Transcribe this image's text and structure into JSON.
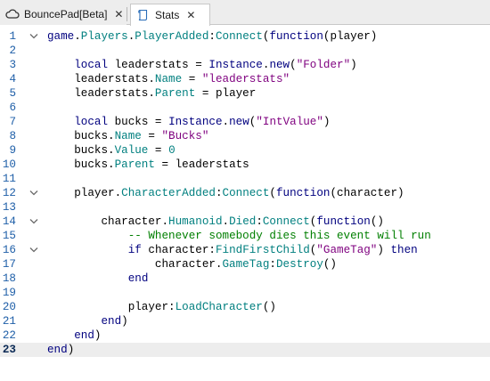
{
  "tabs": [
    {
      "label": "BouncePad[Beta]",
      "icon": "cloud-icon",
      "active": false
    },
    {
      "label": "Stats",
      "icon": "script-icon",
      "active": true
    }
  ],
  "editor": {
    "current_line": 23,
    "lines": [
      {
        "n": "1",
        "fold": true,
        "tokens": [
          [
            "kw",
            "game"
          ],
          [
            "",
            "."
          ],
          [
            "prop",
            "Players"
          ],
          [
            "",
            "."
          ],
          [
            "prop",
            "PlayerAdded"
          ],
          [
            "",
            ":"
          ],
          [
            "prop",
            "Connect"
          ],
          [
            "",
            "("
          ],
          [
            "kw",
            "function"
          ],
          [
            "",
            "(player)"
          ]
        ]
      },
      {
        "n": "2",
        "fold": false,
        "tokens": []
      },
      {
        "n": "3",
        "fold": false,
        "tokens": [
          [
            "",
            "    "
          ],
          [
            "kw",
            "local"
          ],
          [
            "",
            " leaderstats = "
          ],
          [
            "kw",
            "Instance"
          ],
          [
            "",
            "."
          ],
          [
            "kw",
            "new"
          ],
          [
            "",
            "("
          ],
          [
            "str",
            "\"Folder\""
          ],
          [
            "",
            ")"
          ]
        ]
      },
      {
        "n": "4",
        "fold": false,
        "tokens": [
          [
            "",
            "    leaderstats."
          ],
          [
            "prop",
            "Name"
          ],
          [
            "",
            " = "
          ],
          [
            "str",
            "\"leaderstats\""
          ]
        ]
      },
      {
        "n": "5",
        "fold": false,
        "tokens": [
          [
            "",
            "    leaderstats."
          ],
          [
            "prop",
            "Parent"
          ],
          [
            "",
            " = player"
          ]
        ]
      },
      {
        "n": "6",
        "fold": false,
        "tokens": []
      },
      {
        "n": "7",
        "fold": false,
        "tokens": [
          [
            "",
            "    "
          ],
          [
            "kw",
            "local"
          ],
          [
            "",
            " bucks = "
          ],
          [
            "kw",
            "Instance"
          ],
          [
            "",
            "."
          ],
          [
            "kw",
            "new"
          ],
          [
            "",
            "("
          ],
          [
            "str",
            "\"IntValue\""
          ],
          [
            "",
            ")"
          ]
        ]
      },
      {
        "n": "8",
        "fold": false,
        "tokens": [
          [
            "",
            "    bucks."
          ],
          [
            "prop",
            "Name"
          ],
          [
            "",
            " = "
          ],
          [
            "str",
            "\"Bucks\""
          ]
        ]
      },
      {
        "n": "9",
        "fold": false,
        "tokens": [
          [
            "",
            "    bucks."
          ],
          [
            "prop",
            "Value"
          ],
          [
            "",
            " = "
          ],
          [
            "num",
            "0"
          ]
        ]
      },
      {
        "n": "10",
        "fold": false,
        "tokens": [
          [
            "",
            "    bucks."
          ],
          [
            "prop",
            "Parent"
          ],
          [
            "",
            " = leaderstats"
          ]
        ]
      },
      {
        "n": "11",
        "fold": false,
        "tokens": []
      },
      {
        "n": "12",
        "fold": true,
        "tokens": [
          [
            "",
            "    player."
          ],
          [
            "prop",
            "CharacterAdded"
          ],
          [
            "",
            ":"
          ],
          [
            "prop",
            "Connect"
          ],
          [
            "",
            "("
          ],
          [
            "kw",
            "function"
          ],
          [
            "",
            "(character)"
          ]
        ]
      },
      {
        "n": "13",
        "fold": false,
        "tokens": []
      },
      {
        "n": "14",
        "fold": true,
        "tokens": [
          [
            "",
            "        character."
          ],
          [
            "prop",
            "Humanoid"
          ],
          [
            "",
            "."
          ],
          [
            "prop",
            "Died"
          ],
          [
            "",
            ":"
          ],
          [
            "prop",
            "Connect"
          ],
          [
            "",
            "("
          ],
          [
            "kw",
            "function"
          ],
          [
            "",
            "()"
          ]
        ]
      },
      {
        "n": "15",
        "fold": false,
        "tokens": [
          [
            "",
            "            "
          ],
          [
            "cmt",
            "-- Whenever somebody dies this event will run"
          ]
        ]
      },
      {
        "n": "16",
        "fold": true,
        "tokens": [
          [
            "",
            "            "
          ],
          [
            "kw",
            "if"
          ],
          [
            "",
            " character:"
          ],
          [
            "prop",
            "FindFirstChild"
          ],
          [
            "",
            "("
          ],
          [
            "str",
            "\"GameTag\""
          ],
          [
            "",
            ") "
          ],
          [
            "kw",
            "then"
          ]
        ]
      },
      {
        "n": "17",
        "fold": false,
        "tokens": [
          [
            "",
            "                character."
          ],
          [
            "prop",
            "GameTag"
          ],
          [
            "",
            ":"
          ],
          [
            "prop",
            "Destroy"
          ],
          [
            "",
            "()"
          ]
        ]
      },
      {
        "n": "18",
        "fold": false,
        "tokens": [
          [
            "",
            "            "
          ],
          [
            "kw",
            "end"
          ]
        ]
      },
      {
        "n": "19",
        "fold": false,
        "tokens": []
      },
      {
        "n": "20",
        "fold": false,
        "tokens": [
          [
            "",
            "            player:"
          ],
          [
            "prop",
            "LoadCharacter"
          ],
          [
            "",
            "()"
          ]
        ]
      },
      {
        "n": "21",
        "fold": false,
        "tokens": [
          [
            "",
            "        "
          ],
          [
            "kw",
            "end"
          ],
          [
            "",
            ")"
          ]
        ]
      },
      {
        "n": "22",
        "fold": false,
        "tokens": [
          [
            "",
            "    "
          ],
          [
            "kw",
            "end"
          ],
          [
            "",
            ")"
          ]
        ]
      },
      {
        "n": "23",
        "fold": false,
        "tokens": [
          [
            "kw",
            "end"
          ],
          [
            "",
            ")"
          ]
        ]
      }
    ]
  },
  "colors": {
    "keyword": "#00007f",
    "property": "#007f7f",
    "string": "#7f007f",
    "comment": "#007f00",
    "line_number": "#1f5fa8",
    "current_line_bg": "#ededed"
  }
}
